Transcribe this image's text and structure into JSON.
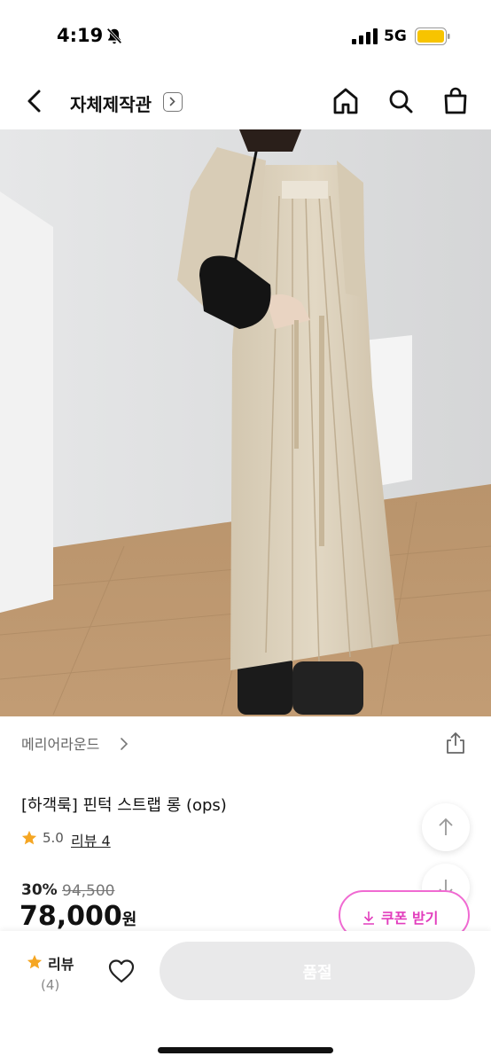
{
  "status_bar": {
    "time": "4:19",
    "network": "5G",
    "icons": [
      "bell-off-icon",
      "signal-icon",
      "battery-icon"
    ]
  },
  "header": {
    "title": "자체제작관",
    "icons": [
      "back-icon",
      "home-icon",
      "search-icon",
      "shopping-bag-icon"
    ]
  },
  "product": {
    "brand": "메리어라운드",
    "title": "[하객룩] 핀턱 스트랩 롱 (ops)",
    "rating": "5.0",
    "review_link": "리뷰 4",
    "discount": "30%",
    "original_price": "94,500",
    "price": "78,000",
    "price_unit": "원",
    "coupon_label": "쿠폰 받기"
  },
  "bottom_bar": {
    "review_label": "리뷰",
    "review_count": "(4)",
    "soldout_label": "품절"
  },
  "colors": {
    "star": "#f5a623",
    "coupon": "#e23dbd",
    "soldout_bg": "#e9e9ea"
  }
}
